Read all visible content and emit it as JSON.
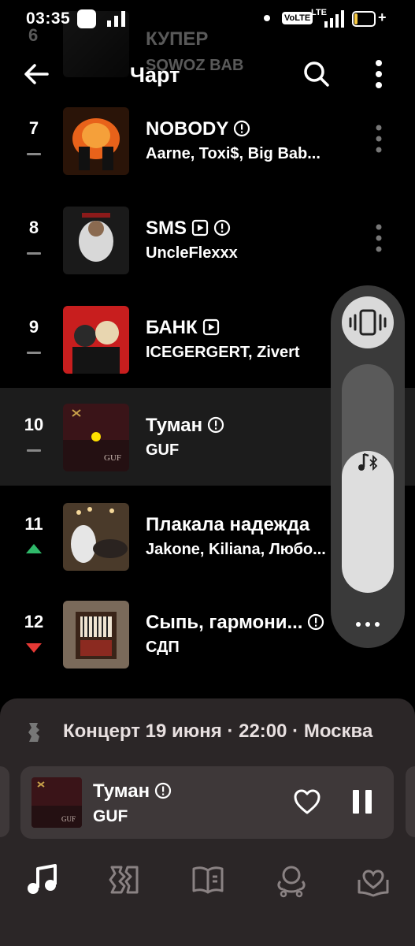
{
  "status_bar": {
    "time": "03:35",
    "volte": "VoLTE",
    "lte": "LTE",
    "battery": "17",
    "battery_level": 0.17,
    "charging": "+"
  },
  "ghost_row": {
    "number": "6",
    "title": "КУПЕР",
    "artist": "SQWOZ BAB"
  },
  "header": {
    "title": "Чарт",
    "back_icon": "arrow-left-icon",
    "search_icon": "search-icon",
    "more_icon": "more-vertical-icon"
  },
  "tracks": [
    {
      "position": "7",
      "trend": "same",
      "title": "NOBODY",
      "explicit": true,
      "video": false,
      "artist": "Aarne, Toxi$, Big Bab..."
    },
    {
      "position": "8",
      "trend": "same",
      "title": "SMS",
      "explicit": true,
      "video": true,
      "artist": "UncleFlexxx"
    },
    {
      "position": "9",
      "trend": "same",
      "title": "БАНК",
      "explicit": false,
      "video": true,
      "artist": "ICEGERGERT, Zivert"
    },
    {
      "position": "10",
      "trend": "same",
      "title": "Туман",
      "explicit": true,
      "video": false,
      "artist": "GUF",
      "active": true
    },
    {
      "position": "11",
      "trend": "up",
      "title": "Плакала надежда",
      "explicit": false,
      "video": false,
      "artist": "Jakone, Kiliana, Любо..."
    },
    {
      "position": "12",
      "trend": "down",
      "title": "Сыпь, гармони...",
      "explicit": true,
      "video": false,
      "artist": "СДП"
    }
  ],
  "volume_panel": {
    "mode_icon": "vibrate-icon",
    "output_icon": "bluetooth-music-icon",
    "level": 0.62,
    "more_icon": "more-horizontal-icon"
  },
  "concert": {
    "text": "Концерт 19 июня · 22:00 · Москва",
    "icon": "ticket-icon"
  },
  "mini_player": {
    "title": "Туман",
    "explicit": true,
    "artist": "GUF",
    "like_icon": "heart-icon",
    "pause_icon": "pause-icon"
  },
  "bottom_nav": [
    {
      "name": "music",
      "icon": "music-note-icon",
      "active": true
    },
    {
      "name": "map",
      "icon": "map-icon",
      "active": false
    },
    {
      "name": "books",
      "icon": "book-icon",
      "active": false
    },
    {
      "name": "kids",
      "icon": "kids-icon",
      "active": false
    },
    {
      "name": "collection",
      "icon": "heart-collection-icon",
      "active": false
    }
  ],
  "colors": {
    "up": "#2fb96a",
    "down": "#e53935",
    "same": "#888888",
    "panel": "#2b2627",
    "active_row": "#1c1c1c"
  }
}
